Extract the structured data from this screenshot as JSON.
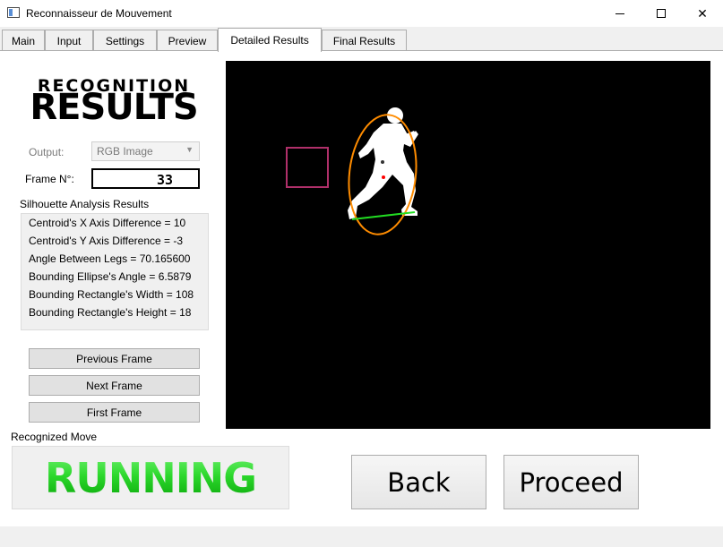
{
  "window": {
    "title": "Reconnaisseur de Mouvement",
    "min_glyph": "",
    "close_glyph": "✕"
  },
  "tabs": [
    {
      "label": "Main"
    },
    {
      "label": "Input"
    },
    {
      "label": "Settings"
    },
    {
      "label": "Preview"
    },
    {
      "label": "Detailed Results",
      "active": true
    },
    {
      "label": "Final Results"
    }
  ],
  "logo": {
    "line1": "RECOGNITION",
    "line2": "RESULTS"
  },
  "output": {
    "label": "Output:",
    "value": "RGB Image"
  },
  "frame": {
    "label": "Frame N°:",
    "value": "33"
  },
  "silhouette": {
    "title": "Silhouette Analysis Results",
    "lines": [
      "Centroid's X Axis Difference = 10",
      "Centroid's Y Axis Difference = -3",
      "Angle Between Legs = 70.165600",
      "Bounding Ellipse's Angle = 6.5879",
      "Bounding Rectangle's Width = 108",
      "Bounding Rectangle's Height = 18"
    ]
  },
  "buttons": {
    "previous": "Previous Frame",
    "next": "Next Frame",
    "first": "First Frame",
    "back": "Back",
    "proceed": "Proceed"
  },
  "recognized": {
    "label": "Recognized Move",
    "value": "RUNNING"
  },
  "colors": {
    "ellipse": "#ff8c00",
    "legs_line": "#22dd22",
    "rect": "#b0306a",
    "centroid": "#ff0000",
    "recognized_green": "#22cc22"
  },
  "icons": {
    "dropdown": "chevron-down-icon"
  }
}
